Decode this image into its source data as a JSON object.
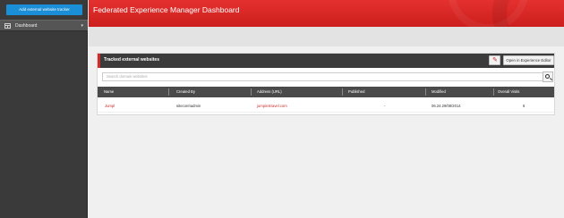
{
  "sidebar": {
    "add_button": "Add external website tracker",
    "items": [
      {
        "label": "Dashboard"
      }
    ]
  },
  "header": {
    "title": "Federated Experience Manager Dashboard"
  },
  "panel": {
    "title": "Tracked external websites",
    "edit_icon": "pencil-icon",
    "open_button": "Open in Experience Editor",
    "search_placeholder": "Search domain websites",
    "columns": [
      "Name",
      "Created By",
      "Address (URL)",
      "Published",
      "Modified",
      "Overall Visits"
    ],
    "rows": [
      {
        "name": "Jumpl",
        "created_by": "sitecore\\admin",
        "address": "jumpinstravel.com",
        "published": "-",
        "modified": "06.24.29/08/2014",
        "visits": "6"
      }
    ]
  },
  "colors": {
    "accent": "#d52b28",
    "primary_button": "#1a8ed6",
    "sidebar": "#3a3a3a"
  }
}
